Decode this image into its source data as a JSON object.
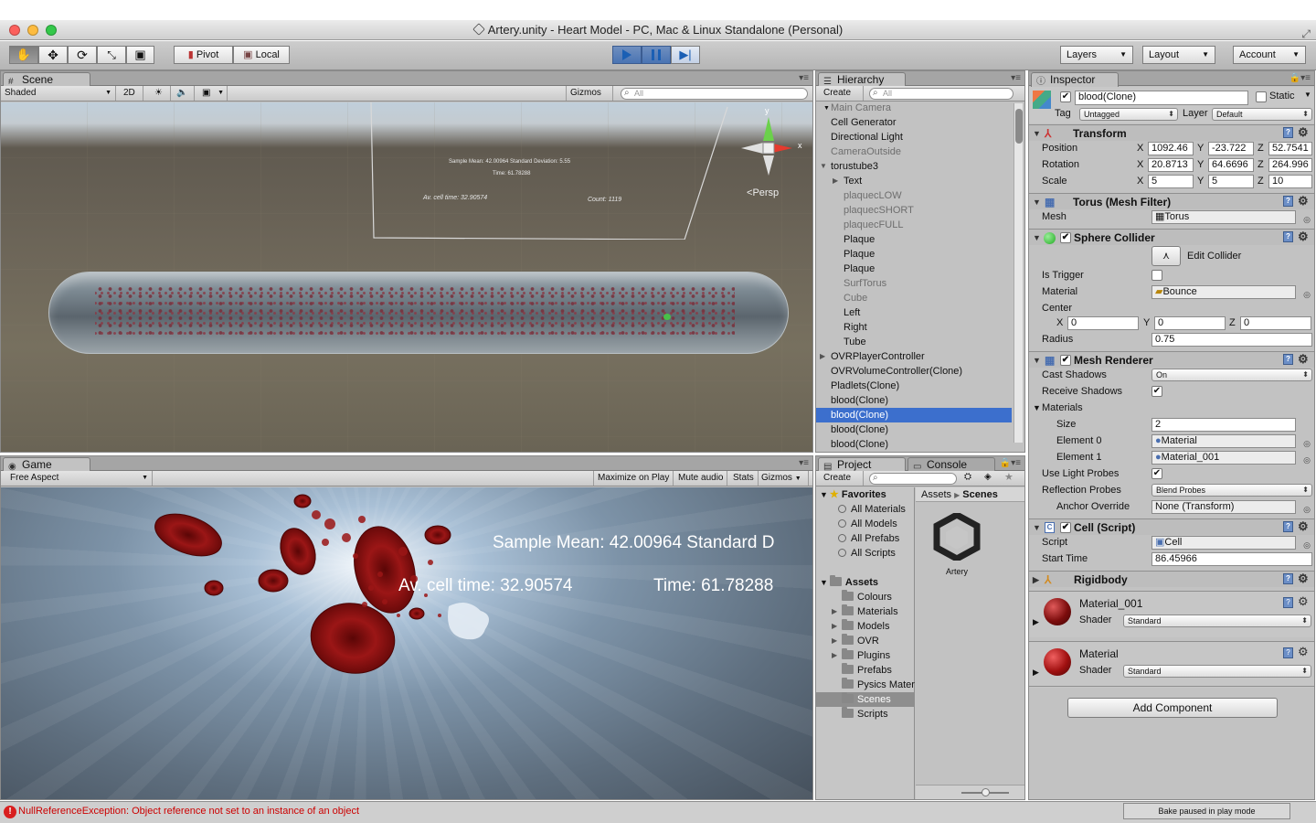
{
  "window": {
    "title": "Artery.unity - Heart Model - PC, Mac & Linux Standalone (Personal)"
  },
  "toolbar": {
    "pivot": "Pivot",
    "local": "Local",
    "layers": "Layers",
    "layout": "Layout",
    "account": "Account"
  },
  "scene": {
    "tab": "Scene",
    "shading": "Shaded",
    "two_d": "2D",
    "gizmos": "Gizmos",
    "search_placeholder": "All",
    "persp": "Persp",
    "axis_y": "y",
    "axis_x": "x",
    "overlay": {
      "stats": "Sample Mean: 42.00964 Standard Deviation: 5.55",
      "time": "Time: 61.78288",
      "avg": "Av. cell time: 32.90574",
      "count": "Count: 1119"
    }
  },
  "game": {
    "tab": "Game",
    "aspect": "Free Aspect",
    "maximize": "Maximize on Play",
    "mute": "Mute audio",
    "stats": "Stats",
    "gizmos": "Gizmos",
    "overlay": {
      "stats": "Sample Mean: 42.00964  Standard D",
      "avg": "Av. cell time: 32.90574",
      "time": "Time: 61.78288"
    }
  },
  "hierarchy": {
    "tab": "Hierarchy",
    "create": "Create",
    "search_placeholder": "All",
    "items": [
      {
        "label": "Main Camera",
        "indent": 0,
        "dim": true
      },
      {
        "label": "Cell Generator",
        "indent": 0
      },
      {
        "label": "Directional Light",
        "indent": 0
      },
      {
        "label": "CameraOutside",
        "indent": 0,
        "dim": true
      },
      {
        "label": "torustube3",
        "indent": 0,
        "fold": "open"
      },
      {
        "label": "Text",
        "indent": 1,
        "fold": "closed"
      },
      {
        "label": "plaquecLOW",
        "indent": 1,
        "dim": true
      },
      {
        "label": "plaquecSHORT",
        "indent": 1,
        "dim": true
      },
      {
        "label": "plaquecFULL",
        "indent": 1,
        "dim": true
      },
      {
        "label": "Plaque",
        "indent": 1
      },
      {
        "label": "Plaque",
        "indent": 1
      },
      {
        "label": "Plaque",
        "indent": 1
      },
      {
        "label": "SurfTorus",
        "indent": 1,
        "dim": true
      },
      {
        "label": "Cube",
        "indent": 1,
        "dim": true
      },
      {
        "label": "Left",
        "indent": 1
      },
      {
        "label": "Right",
        "indent": 1
      },
      {
        "label": "Tube",
        "indent": 1
      },
      {
        "label": "OVRPlayerController",
        "indent": 0,
        "fold": "closed"
      },
      {
        "label": "OVRVolumeController(Clone)",
        "indent": 0
      },
      {
        "label": "Pladlets(Clone)",
        "indent": 0
      },
      {
        "label": "blood(Clone)",
        "indent": 0
      },
      {
        "label": "blood(Clone)",
        "indent": 0,
        "selected": true
      },
      {
        "label": "blood(Clone)",
        "indent": 0
      },
      {
        "label": "blood(Clone)",
        "indent": 0
      }
    ]
  },
  "project": {
    "tab": "Project",
    "console_tab": "Console",
    "create": "Create",
    "favorites_label": "Favorites",
    "favorites": [
      "All Materials",
      "All Models",
      "All Prefabs",
      "All Scripts"
    ],
    "assets_label": "Assets",
    "folders": [
      {
        "label": "Colours",
        "fold": ""
      },
      {
        "label": "Materials",
        "fold": "closed"
      },
      {
        "label": "Models",
        "fold": "closed"
      },
      {
        "label": "OVR",
        "fold": "closed"
      },
      {
        "label": "Plugins",
        "fold": "closed"
      },
      {
        "label": "Prefabs",
        "fold": ""
      },
      {
        "label": "Pysics Materials",
        "fold": ""
      },
      {
        "label": "Scenes",
        "fold": "",
        "selected": true
      },
      {
        "label": "Scripts",
        "fold": ""
      }
    ],
    "breadcrumb": {
      "root": "Assets",
      "current": "Scenes"
    },
    "asset_item": "Artery"
  },
  "inspector": {
    "tab": "Inspector",
    "object_name": "blood(Clone)",
    "static_label": "Static",
    "tag_label": "Tag",
    "tag_value": "Untagged",
    "layer_label": "Layer",
    "layer_value": "Default",
    "transform": {
      "title": "Transform",
      "position": {
        "label": "Position",
        "x": "1092.46",
        "y": "-23.722",
        "z": "52.7541"
      },
      "rotation": {
        "label": "Rotation",
        "x": "20.8713",
        "y": "64.6696",
        "z": "264.996"
      },
      "scale": {
        "label": "Scale",
        "x": "5",
        "y": "5",
        "z": "10"
      }
    },
    "mesh_filter": {
      "title": "Torus (Mesh Filter)",
      "mesh_label": "Mesh",
      "mesh_value": "Torus"
    },
    "sphere_collider": {
      "title": "Sphere Collider",
      "edit_collider": "Edit Collider",
      "is_trigger_label": "Is Trigger",
      "material_label": "Material",
      "material_value": "Bounce",
      "center_label": "Center",
      "cx": "0",
      "cy": "0",
      "cz": "0",
      "radius_label": "Radius",
      "radius_value": "0.75"
    },
    "mesh_renderer": {
      "title": "Mesh Renderer",
      "cast_shadows_label": "Cast Shadows",
      "cast_shadows_value": "On",
      "receive_shadows_label": "Receive Shadows",
      "materials_label": "Materials",
      "size_label": "Size",
      "size_value": "2",
      "element0_label": "Element 0",
      "element0_value": "Material",
      "element1_label": "Element 1",
      "element1_value": "Material_001",
      "light_probes_label": "Use Light Probes",
      "reflection_probes_label": "Reflection Probes",
      "reflection_probes_value": "Blend Probes",
      "anchor_label": "Anchor Override",
      "anchor_value": "None (Transform)"
    },
    "cell_script": {
      "title": "Cell (Script)",
      "script_label": "Script",
      "script_value": "Cell",
      "start_time_label": "Start Time",
      "start_time_value": "86.45966"
    },
    "rigidbody": {
      "title": "Rigidbody"
    },
    "materials": [
      {
        "name": "Material_001",
        "shader_label": "Shader",
        "shader_value": "Standard"
      },
      {
        "name": "Material",
        "shader_label": "Shader",
        "shader_value": "Standard"
      }
    ],
    "add_component": "Add Component"
  },
  "axis_labels": {
    "x": "X",
    "y": "Y",
    "z": "Z"
  },
  "status": {
    "error": "NullReferenceException: Object reference not set to an instance of an object",
    "bake": "Bake paused in play mode"
  },
  "colors": {
    "selection": "#3c6fcd",
    "panel_bg": "#c2c2c2",
    "play_active": "#4a74b3",
    "error": "#cc1111"
  }
}
